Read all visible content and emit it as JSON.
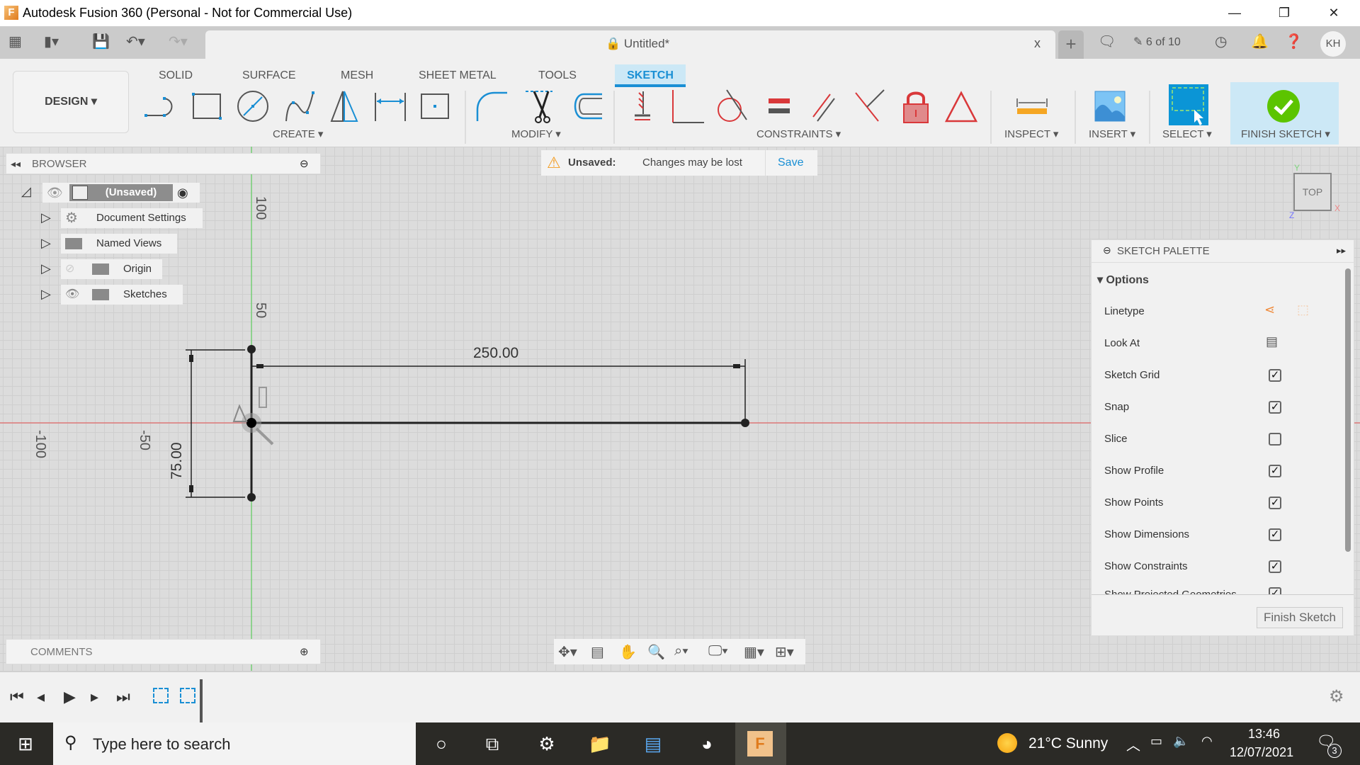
{
  "window": {
    "title": "Autodesk Fusion 360 (Personal - Not for Commercial Use)",
    "minimize": "—",
    "restore": "❐",
    "close": "✕"
  },
  "toolbar": {
    "document_tab": "Untitled*",
    "tab_close": "x",
    "new_tab": "+",
    "jobs_status": "6 of 10",
    "avatar_initials": "KH"
  },
  "ribbon": {
    "workspace": "DESIGN ▾",
    "tabs": [
      "SOLID",
      "SURFACE",
      "MESH",
      "SHEET METAL",
      "TOOLS",
      "SKETCH"
    ],
    "active_tab": "SKETCH",
    "groups": {
      "create": "CREATE ▾",
      "modify": "MODIFY ▾",
      "constraints": "CONSTRAINTS ▾",
      "inspect": "INSPECT ▾",
      "insert": "INSERT ▾",
      "select": "SELECT ▾",
      "finish": "FINISH SKETCH ▾"
    }
  },
  "browser": {
    "header": "BROWSER",
    "root": "(Unsaved)",
    "items": [
      "Document Settings",
      "Named Views",
      "Origin",
      "Sketches"
    ]
  },
  "unsaved_bar": {
    "label": "Unsaved:",
    "message": "Changes may be lost",
    "save": "Save"
  },
  "canvas": {
    "axis_labels": [
      "100",
      "50",
      "-50",
      "-100"
    ],
    "dimensions": {
      "width": "250.00",
      "height": "75.00"
    },
    "viewcube": {
      "face": "TOP",
      "x": "X",
      "y": "Y",
      "z": "Z"
    }
  },
  "palette": {
    "title": "SKETCH PALETTE",
    "section": "Options",
    "rows": [
      {
        "label": "Linetype",
        "type": "icons"
      },
      {
        "label": "Look At",
        "type": "icon"
      },
      {
        "label": "Sketch Grid",
        "checked": true
      },
      {
        "label": "Snap",
        "checked": true
      },
      {
        "label": "Slice",
        "checked": false
      },
      {
        "label": "Show Profile",
        "checked": true
      },
      {
        "label": "Show Points",
        "checked": true
      },
      {
        "label": "Show Dimensions",
        "checked": true
      },
      {
        "label": "Show Constraints",
        "checked": true
      },
      {
        "label": "Show Projected Geometries",
        "checked": true
      }
    ],
    "finish_button": "Finish Sketch"
  },
  "comments": {
    "header": "COMMENTS"
  },
  "taskbar": {
    "search_placeholder": "Type here to search",
    "weather": "21°C  Sunny",
    "time": "13:46",
    "date": "12/07/2021",
    "notifications": "3"
  },
  "colors": {
    "accent": "#1a8fd4",
    "x_axis": "#e06666",
    "y_axis": "#5fcf5f",
    "constraint_red": "#d9383a",
    "finish_green": "#5cc400"
  }
}
